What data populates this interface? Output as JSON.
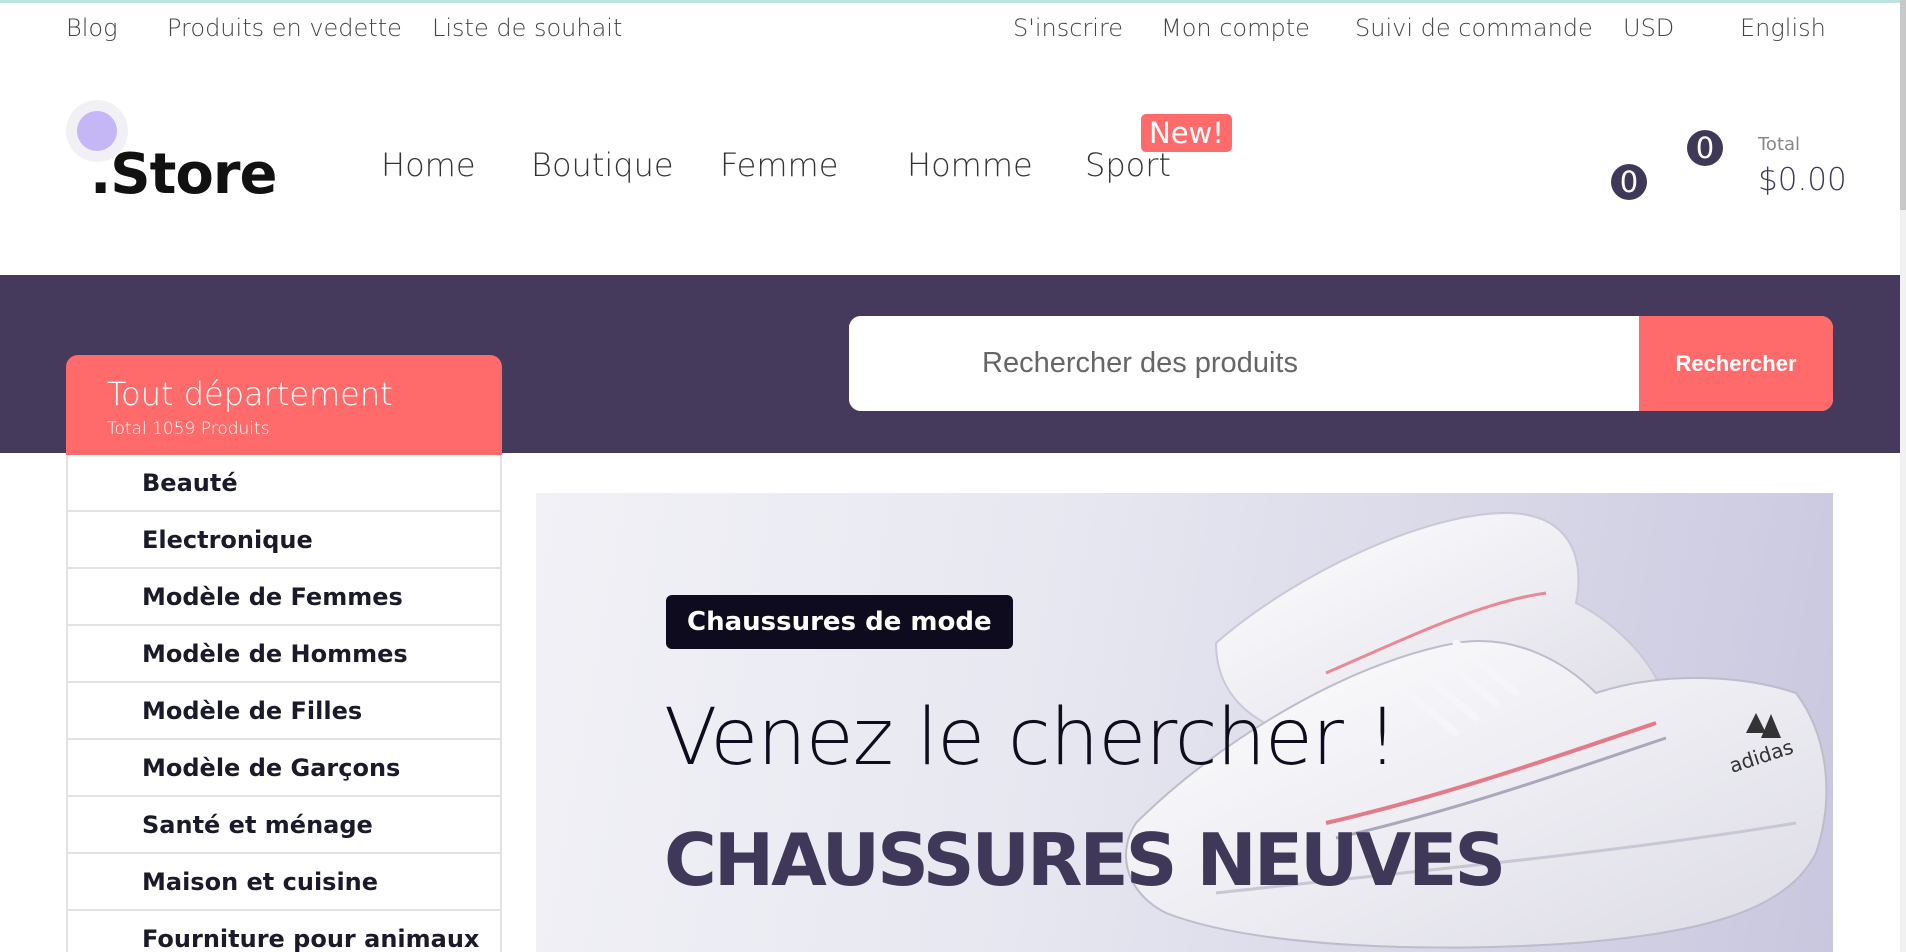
{
  "top_bar": {
    "left_links": [
      "Blog",
      "Produits en vedette",
      "Liste de souhait"
    ],
    "right_links": [
      "S'inscrire",
      "Mon compte",
      "Suivi de commande",
      "USD",
      "English"
    ]
  },
  "brand": {
    "logo_text": ".Store"
  },
  "main_nav": {
    "items": [
      "Home",
      "Boutique",
      "Femme",
      "Homme",
      "Sport"
    ],
    "sport_badge": "New!"
  },
  "cart": {
    "wishlist_count": "0",
    "cart_count": "0",
    "total_label": "Total",
    "total_value": "$0.00"
  },
  "search": {
    "placeholder": "Rechercher des produits",
    "button_label": "Rechercher"
  },
  "departments": {
    "title": "Tout département",
    "subtitle": "Total 1059 Produits",
    "items": [
      "Beauté",
      "Electronique",
      "Modèle de Femmes",
      "Modèle de Hommes",
      "Modèle de Filles",
      "Modèle de Garçons",
      "Santé et ménage",
      "Maison et cuisine",
      "Fourniture pour animaux"
    ]
  },
  "hero": {
    "tag": "Chaussures de mode",
    "line1": "Venez le chercher !",
    "line2": "CHAUSSURES NEUVES"
  },
  "colors": {
    "accent": "#ff6b6b",
    "brand_purple": "#463a5c",
    "dark_navy": "#0e0b1f"
  }
}
